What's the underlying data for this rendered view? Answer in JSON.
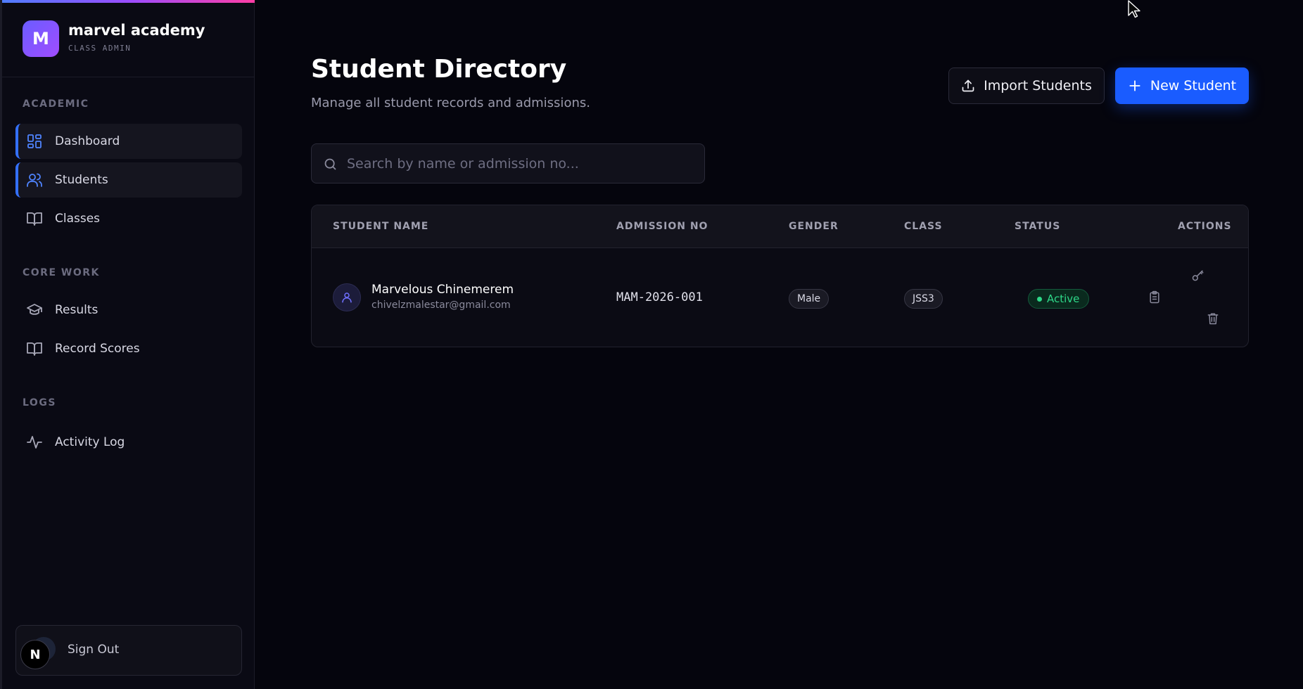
{
  "sidebar": {
    "brand": {
      "initial": "M",
      "name": "marvel academy",
      "role": "CLASS ADMIN"
    },
    "sections": [
      {
        "title": "ACADEMIC",
        "items": [
          {
            "label": "Dashboard",
            "icon": "dashboard-grid-icon",
            "active": true
          },
          {
            "label": "Students",
            "icon": "users-icon",
            "active": true
          },
          {
            "label": "Classes",
            "icon": "book-open-icon",
            "active": false
          }
        ]
      },
      {
        "title": "CORE WORK",
        "items": [
          {
            "label": "Results",
            "icon": "graduation-cap-icon",
            "active": false
          },
          {
            "label": "Record Scores",
            "icon": "book-open-icon",
            "active": false
          }
        ]
      },
      {
        "title": "LOGS",
        "items": [
          {
            "label": "Activity Log",
            "icon": "activity-icon",
            "active": false
          }
        ]
      }
    ],
    "signout": {
      "avatar_initial": "N",
      "label": "Sign Out"
    }
  },
  "header": {
    "title": "Student Directory",
    "subtitle": "Manage all student records and admissions.",
    "import_label": "Import Students",
    "new_label": "New Student"
  },
  "search": {
    "placeholder": "Search by name or admission no...",
    "value": ""
  },
  "table": {
    "columns": [
      "STUDENT NAME",
      "ADMISSION NO",
      "GENDER",
      "CLASS",
      "STATUS",
      "ACTIONS"
    ],
    "rows": [
      {
        "name": "Marvelous Chinemerem",
        "email": "chivelzmalestar@gmail.com",
        "admission_no": "MAM-2026-001",
        "gender": "Male",
        "class": "JSS3",
        "status": "Active",
        "actions": [
          "clipboard-icon",
          "key-icon",
          "trash-icon"
        ]
      }
    ]
  },
  "colors": {
    "accent": "#1a5cff",
    "status_active": "#2ed889",
    "background": "#05050d",
    "sidebar": "#0a0a14"
  }
}
